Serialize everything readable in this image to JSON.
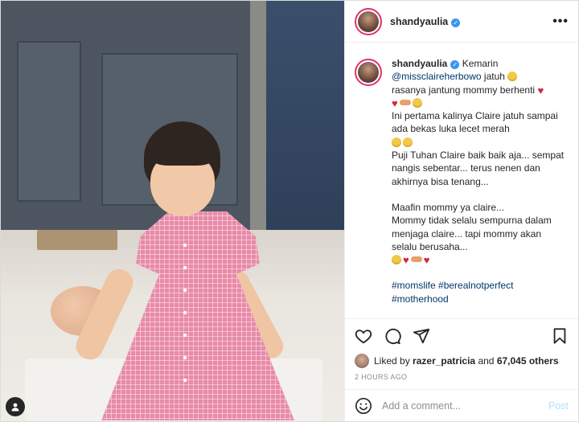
{
  "header": {
    "username": "shandyaulia",
    "more_icon": "more-horizontal-icon"
  },
  "caption": {
    "username": "shandyaulia",
    "first_word": "Kemarin",
    "mention": "@missclaireherbowo",
    "line1_rest": "jatuh",
    "line2": "rasanya jantung mommy berhenti",
    "line4": "Ini pertama kalinya Claire jatuh sampai ada bekas luka lecet merah",
    "line6": "Puji Tuhan Claire baik baik aja... sempat nangis sebentar... terus nenen dan akhirnya bisa tenang...",
    "line8": "Maafin mommy ya claire...",
    "line9": "Mommy tidak selalu sempurna dalam menjaga claire... tapi mommy akan selalu berusaha...",
    "tags": [
      "#momslife",
      "#berealnotperfect",
      "#motherhood"
    ]
  },
  "likes": {
    "prefix": "Liked by",
    "user": "razer_patricia",
    "and": "and",
    "count": "67,045 others"
  },
  "timestamp": "2 HOURS AGO",
  "comment_box": {
    "placeholder": "Add a comment...",
    "post_label": "Post"
  },
  "icons": [
    "heart-icon",
    "comment-icon",
    "share-icon",
    "save-icon",
    "smile-icon",
    "user-tag-icon"
  ],
  "colors": {
    "link": "#00376b",
    "verified": "#3897f0",
    "post_disabled": "#b2dffc"
  }
}
